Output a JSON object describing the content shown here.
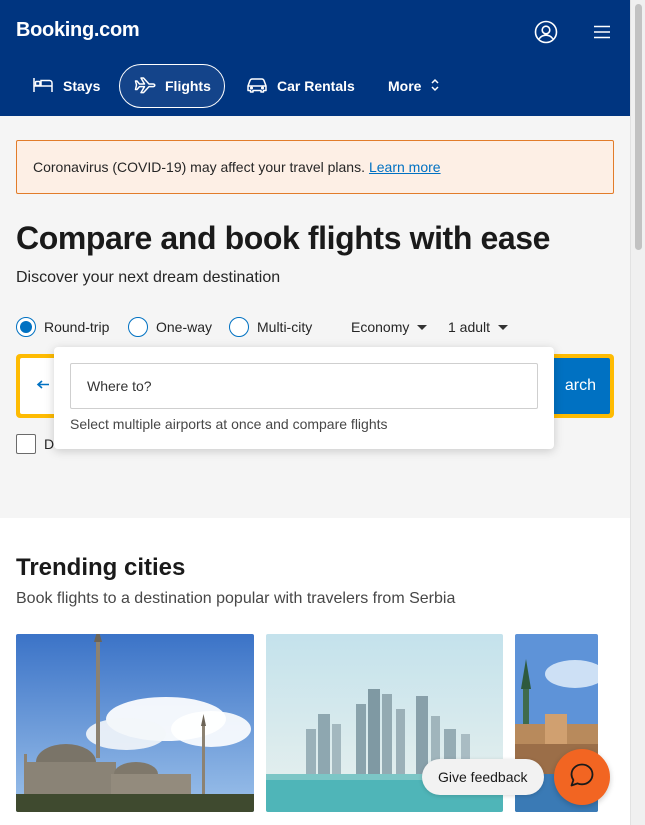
{
  "header": {
    "logo": "Booking.com",
    "nav": [
      {
        "label": "Stays",
        "icon": "bed-icon"
      },
      {
        "label": "Flights",
        "icon": "plane-icon",
        "active": true
      },
      {
        "label": "Car Rentals",
        "icon": "car-icon"
      },
      {
        "label": "More",
        "icon": "chevron-updown-icon"
      }
    ],
    "account_icon": "account-icon",
    "menu_icon": "hamburger-menu-icon"
  },
  "alert": {
    "text": "Coronavirus (COVID-19) may affect your travel plans.",
    "link": "Learn more"
  },
  "hero": {
    "title": "Compare and book flights with ease",
    "subtitle": "Discover your next dream destination"
  },
  "trip_types": [
    {
      "label": "Round-trip",
      "selected": true
    },
    {
      "label": "One-way",
      "selected": false
    },
    {
      "label": "Multi-city",
      "selected": false
    }
  ],
  "cabin_class": {
    "value": "Economy"
  },
  "passengers": {
    "value": "1 adult"
  },
  "search": {
    "button_label": "Search",
    "visible_button_text": "arch",
    "swap_icon": "swap-arrows-icon"
  },
  "direct_flights": {
    "label": "Direct flights only",
    "visible_label": "D"
  },
  "destination_popup": {
    "placeholder": "Where to?",
    "value": "",
    "hint": "Select multiple airports at once and compare flights"
  },
  "trending": {
    "title": "Trending cities",
    "subtitle": "Book flights to a destination popular with travelers from Serbia"
  },
  "feedback": {
    "label": "Give feedback"
  },
  "chat_icon": "chat-bubble-icon",
  "colors": {
    "brand_blue": "#003580",
    "action_blue": "#0071c2",
    "search_yellow": "#febb02",
    "alert_bg": "#fdefe5",
    "alert_border": "#e27c2a",
    "chat_orange": "#f26522"
  }
}
